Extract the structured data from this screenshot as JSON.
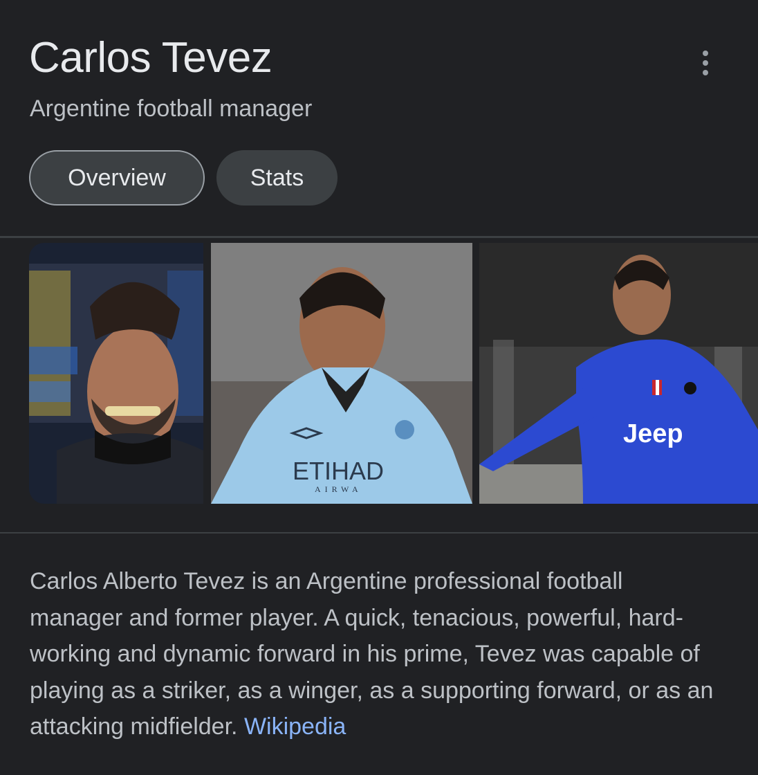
{
  "panel": {
    "title": "Carlos Tevez",
    "subtitle": "Argentine football manager",
    "more_icon": "more-vert-icon"
  },
  "tabs": [
    {
      "label": "Overview",
      "active": true
    },
    {
      "label": "Stats",
      "active": false
    }
  ],
  "images": [
    {
      "name": "tevez-portrait-smiling"
    },
    {
      "name": "tevez-sky-blue-jersey",
      "jersey_text": "ETIHAD",
      "jersey_subtext": "AIRWA"
    },
    {
      "name": "tevez-blue-striped-jersey",
      "jersey_text": "Jeep"
    }
  ],
  "description": {
    "text": "Carlos Alberto Tevez is an Argentine professional football manager and former player. A quick, tenacious, powerful, hard-working and dynamic forward in his prime, Tevez was capable of playing as a striker, as a winger, as a supporting forward, or as an attacking midfielder.",
    "source_link": "Wikipedia"
  },
  "colors": {
    "background": "#202124",
    "tab_fill": "#3c4043",
    "link": "#8ab4f8"
  }
}
